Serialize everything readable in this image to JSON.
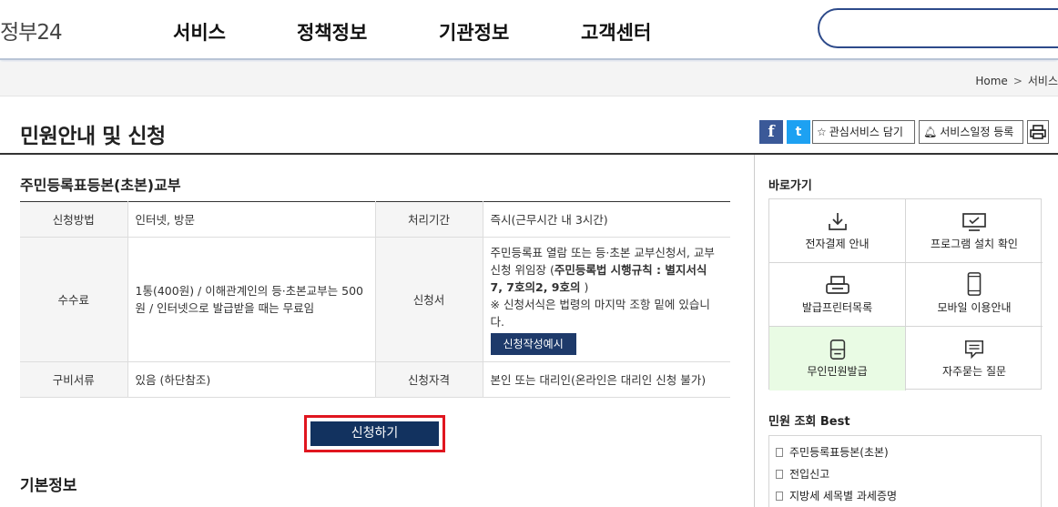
{
  "header": {
    "logo": "정부24",
    "nav": [
      "서비스",
      "정책정보",
      "기관정보",
      "고객센터"
    ],
    "search_value": ""
  },
  "breadcrumb": {
    "home": "Home",
    "sep": ">",
    "current": "서비스"
  },
  "page": {
    "title": "민원안내 및 신청",
    "tools": {
      "facebook": "f",
      "twitter": "t",
      "favorite": "관심서비스 담기",
      "schedule": "서비스일정 등록",
      "print_icon": "printer-icon"
    }
  },
  "section": {
    "title": "주민등록표등본(초본)교부",
    "rows": [
      {
        "label1": "신청방법",
        "value1": "인터넷, 방문",
        "label2": "처리기간",
        "value2": "즉시(근무시간 내 3시간)"
      },
      {
        "label1": "수수료",
        "value1": "1통(400원) / 이해관계인의 등·초본교부는 500원 / 인터넷으로 발급받을 때는 무료임",
        "label2": "신청서",
        "value2_a": "주민등록표 열람 또는 등·초본 교부신청서, 교부신청 위임장 (",
        "value2_b": "주민등록법 시행규칙 : 별지서식 7, 7호의2, 9호의",
        "value2_c": ")",
        "value2_note": "※ 신청서식은 법령의 마지막 조항 밑에 있습니다.",
        "form_button": "신청작성예시"
      },
      {
        "label1": "구비서류",
        "value1": "있음 (하단참조)",
        "label2": "신청자격",
        "value2": "본인 또는 대리인(온라인은 대리인 신청 불가)"
      }
    ],
    "apply_button": "신청하기",
    "next_title": "기본정보"
  },
  "sidebar": {
    "shortcuts_title": "바로가기",
    "shortcuts": [
      {
        "label": "전자결제 안내",
        "icon": "download-icon"
      },
      {
        "label": "프로그램 설치 확인",
        "icon": "monitor-icon"
      },
      {
        "label": "발급프린터목록",
        "icon": "printer-icon"
      },
      {
        "label": "모바일 이용안내",
        "icon": "mobile-icon"
      },
      {
        "label": "무인민원발급",
        "icon": "kiosk-icon"
      },
      {
        "label": "자주묻는 질문",
        "icon": "chat-icon"
      }
    ],
    "best_title": "민원 조회 Best",
    "best": [
      "주민등록표등본(초본)",
      "전입신고",
      "지방세 세목별 과세증명"
    ]
  },
  "colors": {
    "primary": "#12325f",
    "highlight_border": "#e0161f",
    "kiosk_bg": "#e9fbe4"
  }
}
